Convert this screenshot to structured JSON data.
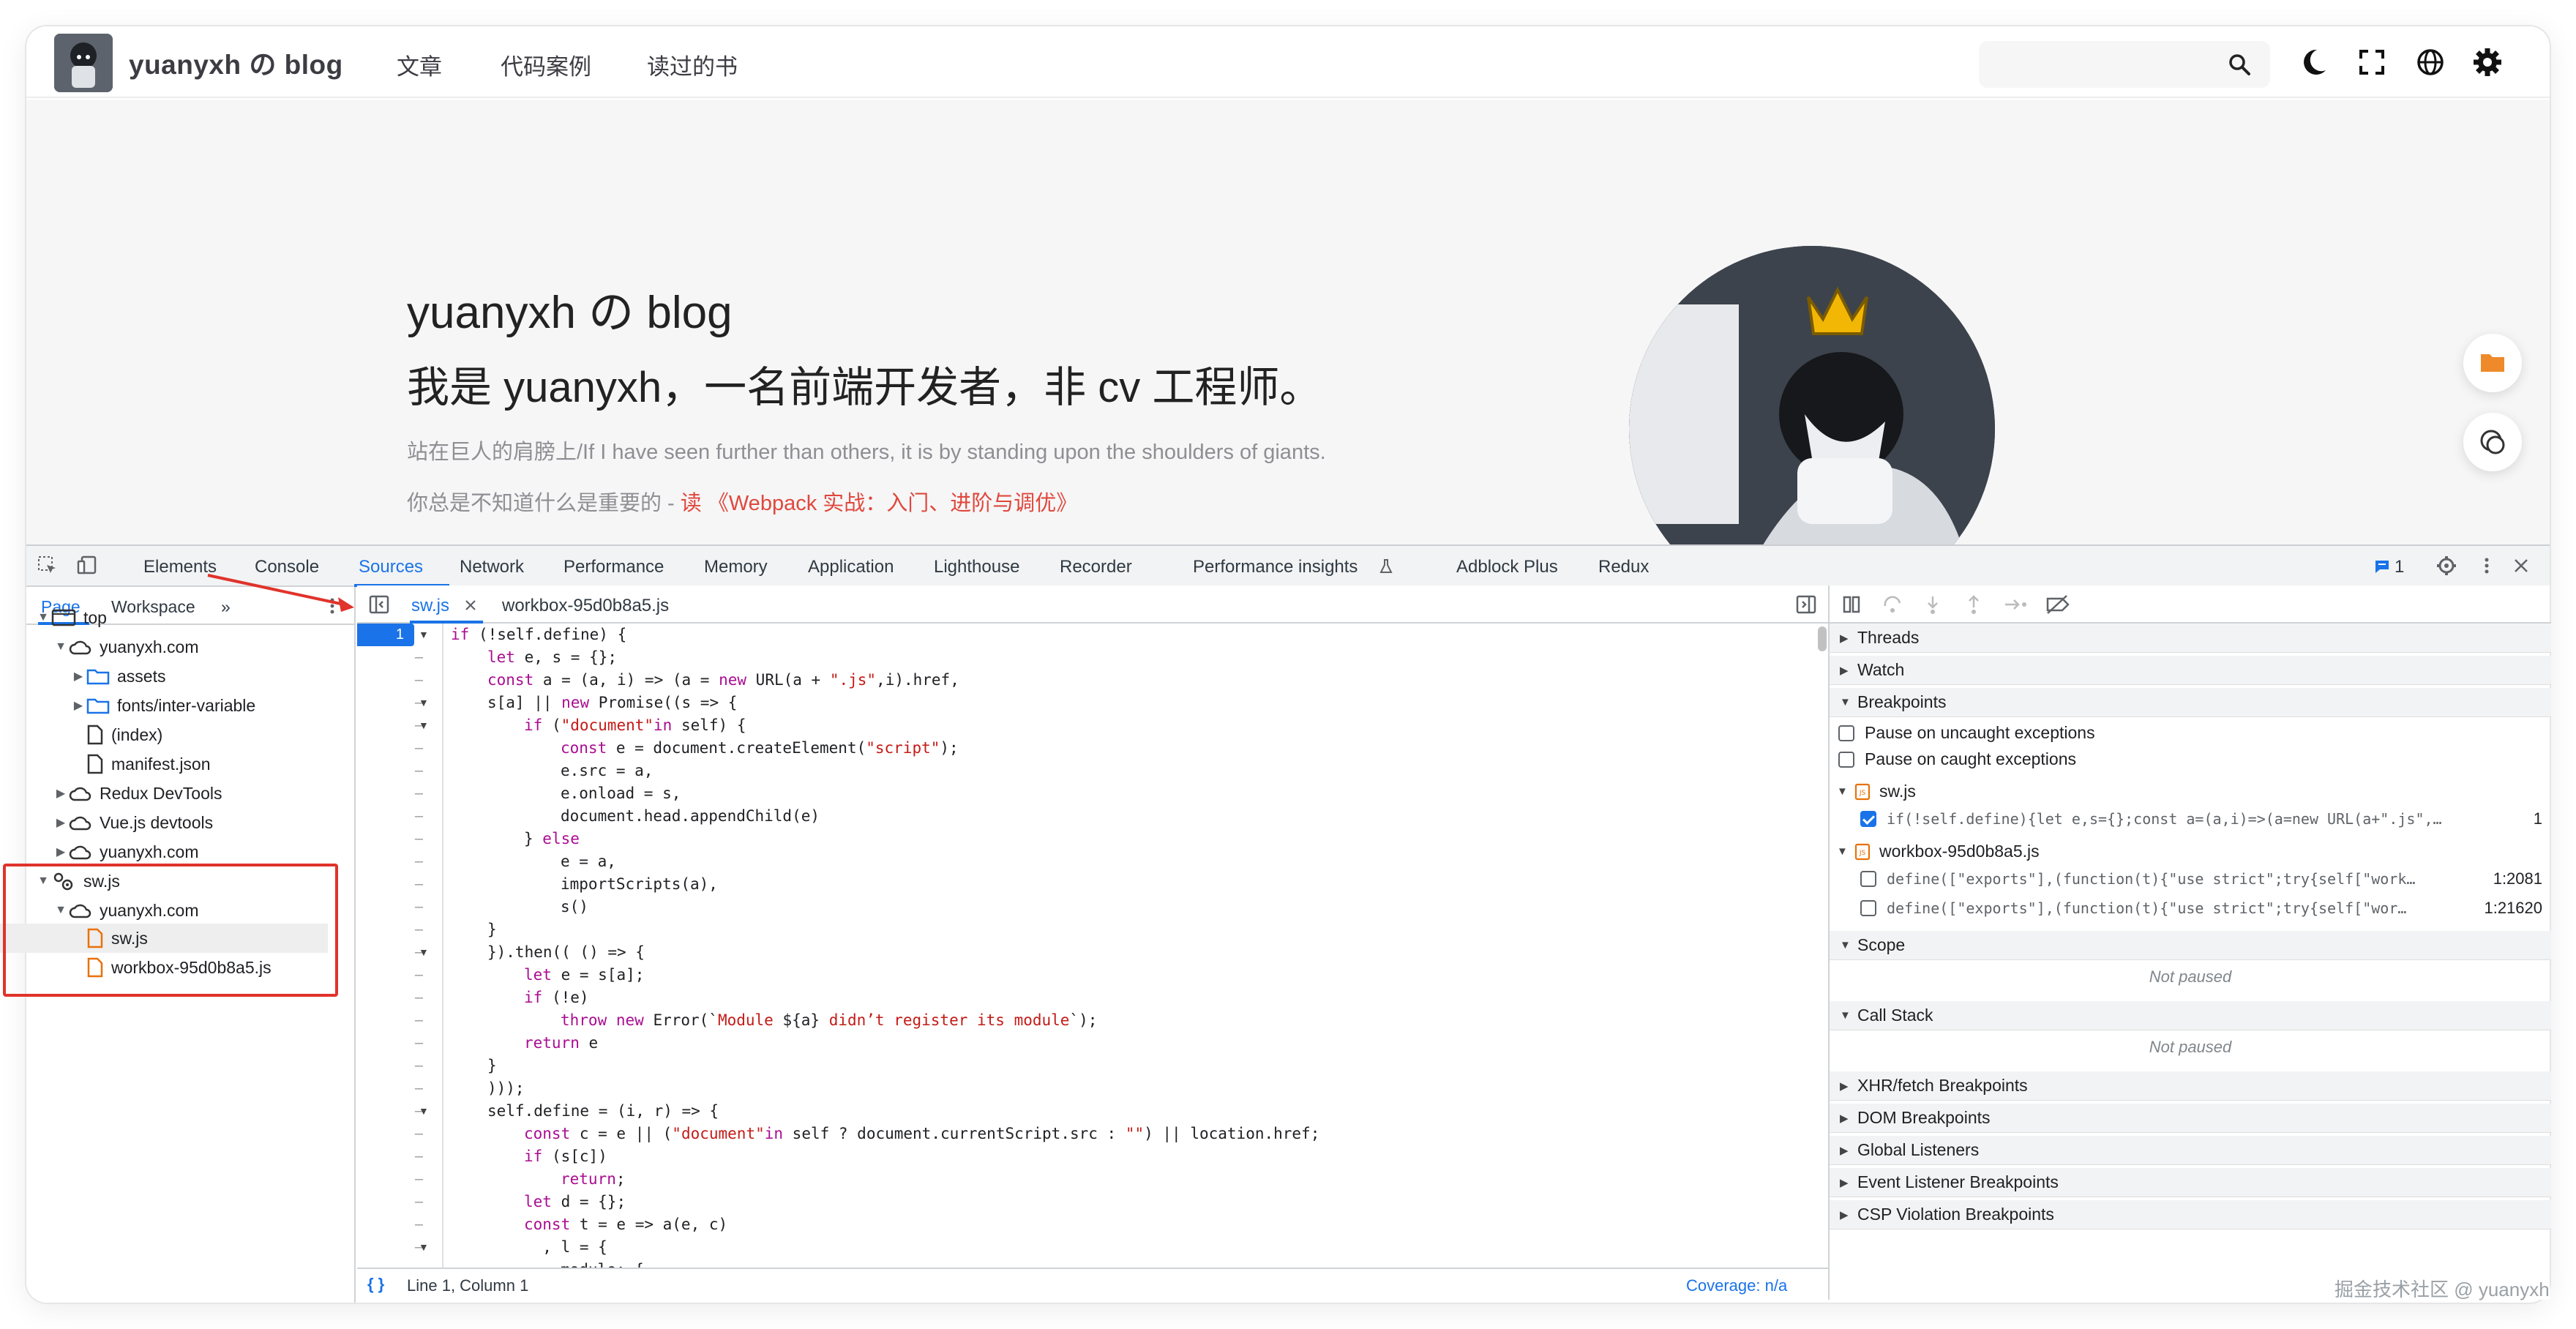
{
  "blog": {
    "site_name": "yuanyxh の blog",
    "nav": [
      "文章",
      "代码案例",
      "读过的书"
    ],
    "icons": [
      "search-icon",
      "moon-icon",
      "fullscreen-icon",
      "globe-icon",
      "gear-icon"
    ],
    "hero": {
      "title": "yuanyxh の blog",
      "subtitle": "我是 yuanyxh，一名前端开发者，非 cv 工程师。",
      "quote": "站在巨人的肩膀上/If I have seen further than others, it is by standing upon the shoulders of giants.",
      "line_prefix": "你总是不知道什么是重要的 - ",
      "line_link": "读 《Webpack 实战：入门、进阶与调优》"
    }
  },
  "devtools": {
    "tabs": [
      "Elements",
      "Console",
      "Sources",
      "Network",
      "Performance",
      "Memory",
      "Application",
      "Lighthouse",
      "Recorder",
      "Performance insights",
      "Adblock Plus",
      "Redux"
    ],
    "active_tab": "Sources",
    "issues_count": "1",
    "navigator": {
      "tabs": [
        "Page",
        "Workspace"
      ],
      "more": "»",
      "tree": [
        "top",
        "yuanyxh.com",
        "assets",
        "fonts/inter-variable",
        "(index)",
        "manifest.json",
        "Redux DevTools",
        "Vue.js devtools",
        "yuanyxh.com",
        "sw.js",
        "yuanyxh.com",
        "sw.js",
        "workbox-95d0b8a5.js"
      ]
    },
    "editor": {
      "tabs": [
        "sw.js",
        "workbox-95d0b8a5.js"
      ],
      "selected_line": "1",
      "status": "Line 1, Column 1",
      "coverage": "Coverage: n/a",
      "braces": "{ }"
    },
    "debugger": {
      "sections": [
        "Threads",
        "Watch",
        "Breakpoints",
        "Scope",
        "Call Stack",
        "XHR/fetch Breakpoints",
        "DOM Breakpoints",
        "Global Listeners",
        "Event Listener Breakpoints",
        "CSP Violation Breakpoints"
      ],
      "pause_uncaught": "Pause on uncaught exceptions",
      "pause_caught": "Pause on caught exceptions",
      "bp_files": [
        {
          "file": "sw.js",
          "items": [
            {
              "code": "if(!self.define){let e,s={};const a=(a,i)=>(a=new URL(a+\".js\",…",
              "line": "1",
              "checked": true
            }
          ]
        },
        {
          "file": "workbox-95d0b8a5.js",
          "items": [
            {
              "code": "define([\"exports\"],(function(t){\"use strict\";try{self[\"work…",
              "line": "1:2081",
              "checked": false
            },
            {
              "code": "define([\"exports\"],(function(t){\"use strict\";try{self[\"wor…",
              "line": "1:21620",
              "checked": false
            }
          ]
        }
      ],
      "not_paused": "Not paused"
    }
  },
  "watermark": "掘金技术社区 @ yuanyxh"
}
